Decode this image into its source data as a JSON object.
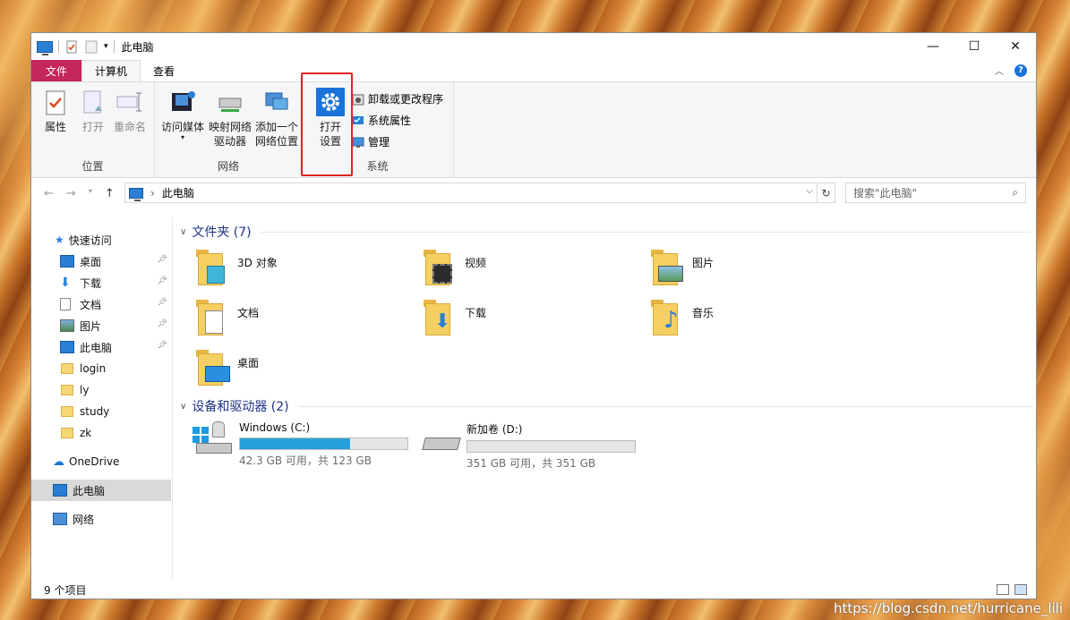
{
  "window": {
    "title": "此电脑"
  },
  "tabs": [
    {
      "label": "文件"
    },
    {
      "label": "计算机"
    },
    {
      "label": "查看"
    }
  ],
  "ribbon": {
    "location_group": {
      "label": "位置",
      "buttons": [
        {
          "label": "属性"
        },
        {
          "label": "打开"
        },
        {
          "label": "重命名"
        }
      ]
    },
    "network_group": {
      "label": "网络",
      "buttons": [
        {
          "label": "访问媒体"
        },
        {
          "label": "映射网络\n驱动器"
        },
        {
          "label": "添加一个\n网络位置"
        }
      ]
    },
    "system_group": {
      "label": "系统",
      "open_settings": "打开\n设置",
      "small_buttons": [
        {
          "label": "卸载或更改程序"
        },
        {
          "label": "系统属性"
        },
        {
          "label": "管理"
        }
      ]
    }
  },
  "address": {
    "path": "此电脑",
    "search_placeholder": "搜索\"此电脑\""
  },
  "sidebar": {
    "quick_access": "快速访问",
    "items": [
      {
        "label": "桌面",
        "pinned": true
      },
      {
        "label": "下载",
        "pinned": true
      },
      {
        "label": "文档",
        "pinned": true
      },
      {
        "label": "图片",
        "pinned": true
      },
      {
        "label": "此电脑",
        "pinned": true
      },
      {
        "label": "login",
        "pinned": false
      },
      {
        "label": "ly",
        "pinned": false
      },
      {
        "label": "study",
        "pinned": false
      },
      {
        "label": "zk",
        "pinned": false
      }
    ],
    "onedrive": "OneDrive",
    "this_pc": "此电脑",
    "network": "网络"
  },
  "folders": {
    "header": "文件夹 (7)",
    "items": [
      {
        "name": "3D 对象",
        "icon": "3d-objects-icon"
      },
      {
        "name": "视频",
        "icon": "videos-icon"
      },
      {
        "name": "图片",
        "icon": "pictures-icon"
      },
      {
        "name": "文档",
        "icon": "documents-icon"
      },
      {
        "name": "下载",
        "icon": "downloads-icon"
      },
      {
        "name": "音乐",
        "icon": "music-icon"
      },
      {
        "name": "桌面",
        "icon": "desktop-icon"
      }
    ]
  },
  "drives": {
    "header": "设备和驱动器 (2)",
    "items": [
      {
        "name": "Windows (C:)",
        "free": "42.3 GB 可用，共 123 GB",
        "used_fraction": 0.656
      },
      {
        "name": "新加卷 (D:)",
        "free": "351 GB 可用，共 351 GB",
        "used_fraction": 0.0
      }
    ]
  },
  "status": {
    "item_count": "9 个项目"
  },
  "watermark": "https://blog.csdn.net/hurricane_lili",
  "colors": {
    "file_tab": "#c4265e",
    "drive_bar": "#26a0da",
    "highlight_box": "#e02222",
    "section_header": "#1e3287"
  }
}
